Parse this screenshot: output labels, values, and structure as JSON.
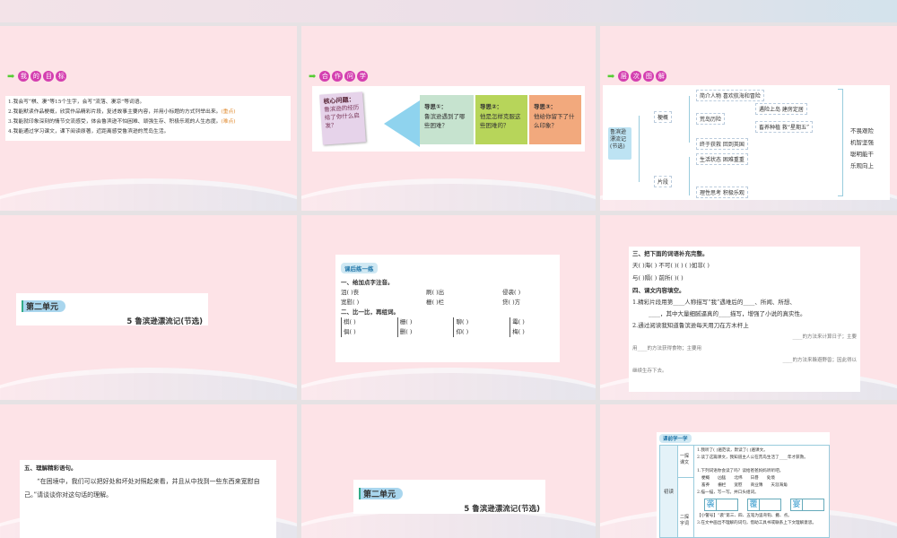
{
  "slides": {
    "s1": {
      "header": [
        "我",
        "的",
        "目",
        "标"
      ],
      "lines": [
        "1.我会写“棋、凄”等15个生字，会写“流落、凄凉”等词语。",
        "2.我能默读作品梗概，欣赏作品精彩片段，复述故事主要内容，并用小标题的方式列举出来。",
        "3.我能就印象深刻的情节交流感受，体会鲁滨逊不怕困难、顽强生存、积极乐观的人生态度。",
        "4.我能通过学习课文，课下阅读原著，近距离感受鲁滨逊的荒岛生活。"
      ],
      "tag2": "(重点)",
      "tag3": "(难点)"
    },
    "s2": {
      "header": [
        "合",
        "作",
        "问",
        "学"
      ],
      "core_title": "核心问题：",
      "core_text": "鲁滨逊的经历给了你什么启发？",
      "guides": [
        {
          "title": "导思①：",
          "text": "鲁滨逊遇到了哪些困难？"
        },
        {
          "title": "导思②：",
          "text": "他是怎样克服这些困难的？"
        },
        {
          "title": "导思③：",
          "text": "他给你留下了什么印象？"
        }
      ]
    },
    "s3": {
      "header": [
        "层",
        "次",
        "图",
        "解"
      ],
      "root": "鲁滨逊漂流记(节选)",
      "b1": "梗概",
      "b2": "片段",
      "n1": "简介人物  喜欢航海和冒险",
      "n2": "荒岛历险",
      "n2a": "遇险上岛  建房定居",
      "n2b": "畜养种植  救“星期五”",
      "n3": "终于获救  回到英国",
      "n4": "生活状态  困难重重",
      "n5": "理性思考  积极乐观",
      "summary": [
        "不畏艰险",
        "机智坚强",
        "聪明能干",
        "乐观向上"
      ]
    },
    "s4": {
      "unit": "第二单元",
      "title": "5  鲁滨逊漂流记(节选)"
    },
    "s5": {
      "chip": "课后练一练",
      "q1": "一、给加点字注音。",
      "row1": [
        "沮(    )丧",
        "刷(    )出",
        "侵袭(    )"
      ],
      "row2": [
        "宽慰(    )",
        "栅(    )栏",
        "贷(    )方"
      ],
      "q2": "二、比一比，再组词。",
      "pairs": [
        [
          "棋(    )",
          "俱(    )"
        ],
        [
          "栅(    )",
          "删(    )"
        ],
        [
          "聊(    )",
          "仰(    )"
        ],
        [
          "霉(    )",
          "梅(    )"
        ]
      ]
    },
    "s6": {
      "q3": "三、把下面的词语补充完整。",
      "l1": "天(  )海(  )   不可(  )(  )   (  )如非(  )",
      "l2": "与(  )隔(  )   前所(  )(  )",
      "q4": "四、课文内容填空。",
      "l3": "1.精彩片段用第____人称描写“我”遇难后的____、所闻、所想、",
      "l4": "____，其中大量细腻逼真的____描写，增强了小说的真实性。",
      "l5": "2.通过阅读我知道鲁滨逊每天用刀在方木杆上",
      "l6": "____的方法来计算日子；主要",
      "l7": "用____的方法获得食物；主要用",
      "l8": "____的方法来躲避野兽；因此得以",
      "l9": "继续生存下去。"
    },
    "s7": {
      "q5": "五、理解精彩语句。",
      "quote": "“在困境中，我们可以把好处和坏处对照起来看，并且从中找到一些东西来宽慰自己。”请谈谈你对这句话的理解。"
    },
    "s8": {
      "unit": "第二单元",
      "title": "5  鲁滨逊漂流记(节选)"
    },
    "s9": {
      "chip": "课前学一学",
      "side": "初读",
      "sec1": "一探课文",
      "sec2": "二探字词",
      "l1": "1.我听了(    )遍范读，默读了(    )遍课文。",
      "l2": "2.读了这篇课文，我知道主人公在荒岛生活了____年才获救。",
      "l3": "1.下列词语你会读了吗？读给爸爸妈妈听听吧。",
      "w1": [
        "梗概",
        "凶猛",
        "北纬",
        "日晷",
        "处境"
      ],
      "w2": [
        "畜养",
        "栅栏",
        "宽慰",
        "商业簿",
        "天涯海角"
      ],
      "l4": "2.描一描，写一写。并口头组词。",
      "chars": [
        "袭",
        "覆",
        "宴"
      ],
      "l5": "【小警号】“袭”第三、四、五笔为竖弯钩、撇、点。",
      "l6": "3.在文中画出不理解的词句，借助工具书或联系上下文理解意思。"
    }
  }
}
